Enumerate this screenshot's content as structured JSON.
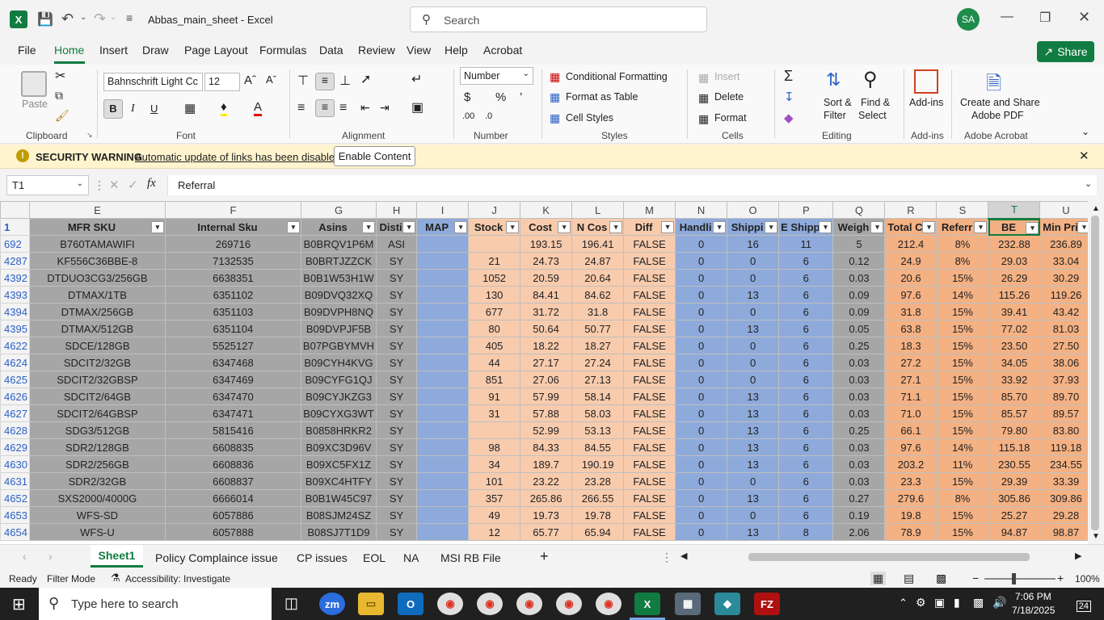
{
  "app": {
    "title": "Abbas_main_sheet  -  Excel",
    "search_placeholder": "Search",
    "avatar": "SA",
    "share": "Share"
  },
  "menu": [
    "File",
    "Home",
    "Insert",
    "Draw",
    "Page Layout",
    "Formulas",
    "Data",
    "Review",
    "View",
    "Help",
    "Acrobat"
  ],
  "ribbon": {
    "paste": "Paste",
    "clipboard": "Clipboard",
    "font_name": "Bahnschrift Light Cc",
    "font_size": "12",
    "font": "Font",
    "alignment": "Alignment",
    "number_format": "Number",
    "number": "Number",
    "cond_format": "Conditional Formatting",
    "format_table": "Format as Table",
    "cell_styles": "Cell Styles",
    "styles": "Styles",
    "insert": "Insert",
    "delete": "Delete",
    "format": "Format",
    "cells": "Cells",
    "sort_filter_1": "Sort &",
    "sort_filter_2": "Filter",
    "find_select_1": "Find &",
    "find_select_2": "Select",
    "editing": "Editing",
    "addins": "Add-ins",
    "addins_group": "Add-ins",
    "pdf_1": "Create and Share",
    "pdf_2": "Adobe PDF",
    "acrobat_group": "Adobe Acrobat"
  },
  "security": {
    "label": "SECURITY WARNING",
    "message": "Automatic update of links has been disabled",
    "button": "Enable Content"
  },
  "formula": {
    "name_box": "T1",
    "fx": "fx",
    "content": "Referral"
  },
  "columns": [
    "E",
    "F",
    "G",
    "H",
    "I",
    "J",
    "K",
    "L",
    "M",
    "N",
    "O",
    "P",
    "Q",
    "R",
    "S",
    "T",
    "U"
  ],
  "headers": [
    "MFR SKU",
    "Internal Sku",
    "Asins",
    "Disti",
    "MAP",
    "Stock",
    "Cost",
    "N Cos",
    "Diff",
    "Handli",
    "Shippi",
    "E Shipp",
    "Weigh",
    "Total C",
    "Referr",
    "BE",
    "Min Pri"
  ],
  "rows": [
    [
      "692",
      "B760TAMAWIFI",
      "269716",
      "B0BRQV1P6M",
      "ASI",
      "",
      "",
      "193.15",
      "196.41",
      "FALSE",
      "0",
      "16",
      "11",
      "5",
      "212.4",
      "8%",
      "232.88",
      "236.89"
    ],
    [
      "4287",
      "KF556C36BBE-8",
      "7132535",
      "B0BRTJZZCK",
      "SY",
      "",
      "21",
      "24.73",
      "24.87",
      "FALSE",
      "0",
      "0",
      "6",
      "0.12",
      "24.9",
      "8%",
      "29.03",
      "33.04"
    ],
    [
      "4392",
      "DTDUO3CG3/256GB",
      "6638351",
      "B0B1W53H1W",
      "SY",
      "",
      "1052",
      "20.59",
      "20.64",
      "FALSE",
      "0",
      "0",
      "6",
      "0.03",
      "20.6",
      "15%",
      "26.29",
      "30.29"
    ],
    [
      "4393",
      "DTMAX/1TB",
      "6351102",
      "B09DVQ32XQ",
      "SY",
      "",
      "130",
      "84.41",
      "84.62",
      "FALSE",
      "0",
      "13",
      "6",
      "0.09",
      "97.6",
      "14%",
      "115.26",
      "119.26"
    ],
    [
      "4394",
      "DTMAX/256GB",
      "6351103",
      "B09DVPH8NQ",
      "SY",
      "",
      "677",
      "31.72",
      "31.8",
      "FALSE",
      "0",
      "0",
      "6",
      "0.09",
      "31.8",
      "15%",
      "39.41",
      "43.42"
    ],
    [
      "4395",
      "DTMAX/512GB",
      "6351104",
      "B09DVPJF5B",
      "SY",
      "",
      "80",
      "50.64",
      "50.77",
      "FALSE",
      "0",
      "13",
      "6",
      "0.05",
      "63.8",
      "15%",
      "77.02",
      "81.03"
    ],
    [
      "4622",
      "SDCE/128GB",
      "5525127",
      "B07PGBYMVH",
      "SY",
      "",
      "405",
      "18.22",
      "18.27",
      "FALSE",
      "0",
      "0",
      "6",
      "0.25",
      "18.3",
      "15%",
      "23.50",
      "27.50"
    ],
    [
      "4624",
      "SDCIT2/32GB",
      "6347468",
      "B09CYH4KVG",
      "SY",
      "",
      "44",
      "27.17",
      "27.24",
      "FALSE",
      "0",
      "0",
      "6",
      "0.03",
      "27.2",
      "15%",
      "34.05",
      "38.06"
    ],
    [
      "4625",
      "SDCIT2/32GBSP",
      "6347469",
      "B09CYFG1QJ",
      "SY",
      "",
      "851",
      "27.06",
      "27.13",
      "FALSE",
      "0",
      "0",
      "6",
      "0.03",
      "27.1",
      "15%",
      "33.92",
      "37.93"
    ],
    [
      "4626",
      "SDCIT2/64GB",
      "6347470",
      "B09CYJKZG3",
      "SY",
      "",
      "91",
      "57.99",
      "58.14",
      "FALSE",
      "0",
      "13",
      "6",
      "0.03",
      "71.1",
      "15%",
      "85.70",
      "89.70"
    ],
    [
      "4627",
      "SDCIT2/64GBSP",
      "6347471",
      "B09CYXG3WT",
      "SY",
      "",
      "31",
      "57.88",
      "58.03",
      "FALSE",
      "0",
      "13",
      "6",
      "0.03",
      "71.0",
      "15%",
      "85.57",
      "89.57"
    ],
    [
      "4628",
      "SDG3/512GB",
      "5815416",
      "B0858HRKR2",
      "SY",
      "",
      "",
      "52.99",
      "53.13",
      "FALSE",
      "0",
      "13",
      "6",
      "0.25",
      "66.1",
      "15%",
      "79.80",
      "83.80"
    ],
    [
      "4629",
      "SDR2/128GB",
      "6608835",
      "B09XC3D96V",
      "SY",
      "",
      "98",
      "84.33",
      "84.55",
      "FALSE",
      "0",
      "13",
      "6",
      "0.03",
      "97.6",
      "14%",
      "115.18",
      "119.18"
    ],
    [
      "4630",
      "SDR2/256GB",
      "6608836",
      "B09XC5FX1Z",
      "SY",
      "",
      "34",
      "189.7",
      "190.19",
      "FALSE",
      "0",
      "13",
      "6",
      "0.03",
      "203.2",
      "11%",
      "230.55",
      "234.55"
    ],
    [
      "4631",
      "SDR2/32GB",
      "6608837",
      "B09XC4HTFY",
      "SY",
      "",
      "101",
      "23.22",
      "23.28",
      "FALSE",
      "0",
      "0",
      "6",
      "0.03",
      "23.3",
      "15%",
      "29.39",
      "33.39"
    ],
    [
      "4652",
      "SXS2000/4000G",
      "6666014",
      "B0B1W45C97",
      "SY",
      "",
      "357",
      "265.86",
      "266.55",
      "FALSE",
      "0",
      "13",
      "6",
      "0.27",
      "279.6",
      "8%",
      "305.86",
      "309.86"
    ],
    [
      "4653",
      "WFS-SD",
      "6057886",
      "B08SJM24SZ",
      "SY",
      "",
      "49",
      "19.73",
      "19.78",
      "FALSE",
      "0",
      "0",
      "6",
      "0.19",
      "19.8",
      "15%",
      "25.27",
      "29.28"
    ],
    [
      "4654",
      "WFS-U",
      "6057888",
      "B08SJ7T1D9",
      "SY",
      "",
      "12",
      "65.77",
      "65.94",
      "FALSE",
      "0",
      "13",
      "8",
      "2.06",
      "78.9",
      "15%",
      "94.87",
      "98.87"
    ]
  ],
  "sheets": [
    "Sheet1",
    "Policy Complaince issue",
    "CP issues",
    "EOL",
    "NA",
    "MSI RB File"
  ],
  "status": {
    "ready": "Ready",
    "filter": "Filter Mode",
    "accessibility": "Accessibility: Investigate",
    "zoom": "100%"
  },
  "taskbar": {
    "search": "Type here to search",
    "time": "7:06 PM",
    "date": "7/18/2025",
    "notif": "24"
  }
}
